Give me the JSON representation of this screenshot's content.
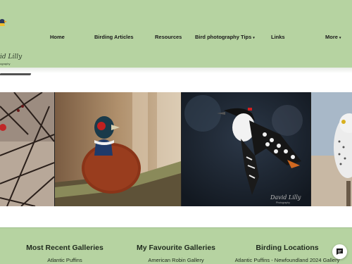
{
  "header": {
    "logo_text": "id Lilly",
    "logo_subtext": "ography",
    "nav": [
      {
        "label": "Home",
        "has_dropdown": false
      },
      {
        "label": "Birding Articles",
        "has_dropdown": false
      },
      {
        "label": "Resources",
        "has_dropdown": false
      },
      {
        "label": "Bird photography Tips",
        "has_dropdown": true
      },
      {
        "label": "Links",
        "has_dropdown": false
      },
      {
        "label": "More",
        "has_dropdown": true
      }
    ],
    "caret": "▾"
  },
  "gallery": {
    "slides": [
      "bird-on-branches-photo",
      "ring-necked-pheasant-photo",
      "downy-woodpecker-photo",
      "snowy-owl-photo"
    ],
    "watermark_text": "David Lilly",
    "watermark_sub": "Photography"
  },
  "footer": {
    "columns": [
      {
        "heading": "Most Recent Galleries",
        "first_link": "Atlantic Puffins"
      },
      {
        "heading": "My Favourite Galleries",
        "first_link": "American Robin Gallery"
      },
      {
        "heading": "Birding Locations",
        "first_link": "Atlantic Puffins - Newfoundland 2024 Gallery"
      }
    ]
  },
  "colors": {
    "header_bg": "#b6d3a1",
    "footer_bg": "#b6d3a1",
    "text": "#1a1a1a"
  },
  "icons": [
    "logo-bird-icon",
    "chat-icon"
  ]
}
